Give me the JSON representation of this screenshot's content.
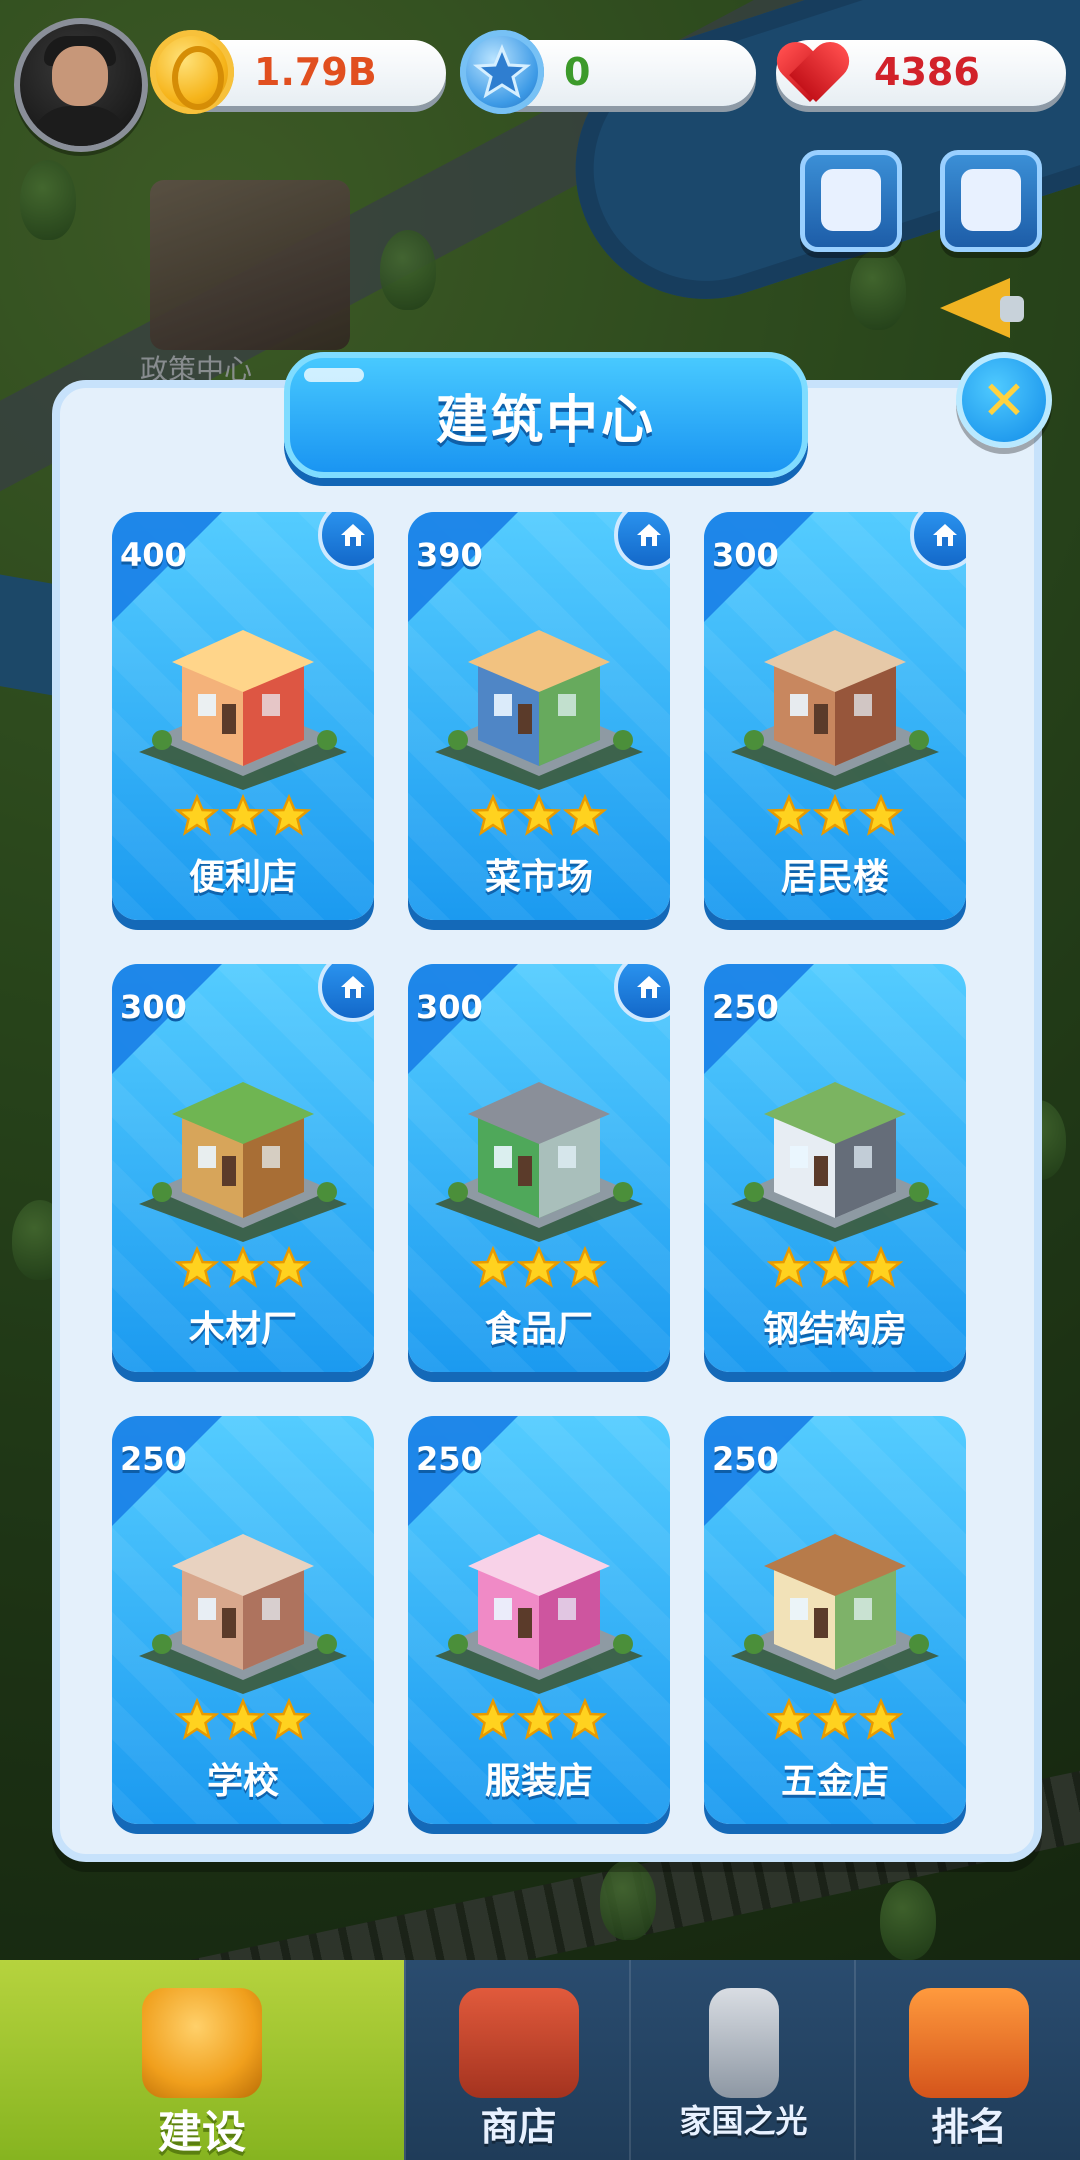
{
  "resources": {
    "coins": "1.79B",
    "stars": "0",
    "hearts": "4386"
  },
  "map": {
    "policy_center_label": "政策中心"
  },
  "modal": {
    "title": "建筑中心",
    "close_symbol": "✕"
  },
  "buildings": [
    {
      "cost": "400",
      "name": "便利店",
      "stars": 3,
      "home_badge": true
    },
    {
      "cost": "390",
      "name": "菜市场",
      "stars": 3,
      "home_badge": true
    },
    {
      "cost": "300",
      "name": "居民楼",
      "stars": 3,
      "home_badge": true
    },
    {
      "cost": "300",
      "name": "木材厂",
      "stars": 3,
      "home_badge": true
    },
    {
      "cost": "300",
      "name": "食品厂",
      "stars": 3,
      "home_badge": true
    },
    {
      "cost": "250",
      "name": "钢结构房",
      "stars": 3,
      "home_badge": false
    },
    {
      "cost": "250",
      "name": "学校",
      "stars": 3,
      "home_badge": false
    },
    {
      "cost": "250",
      "name": "服装店",
      "stars": 3,
      "home_badge": false
    },
    {
      "cost": "250",
      "name": "五金店",
      "stars": 3,
      "home_badge": false
    }
  ],
  "nav": {
    "items": [
      {
        "label": "建设",
        "active": true,
        "icon": "helmet-icon"
      },
      {
        "label": "商店",
        "active": false,
        "icon": "shop-icon"
      },
      {
        "label": "家国之光",
        "active": false,
        "icon": "rocket-icon"
      },
      {
        "label": "排名",
        "active": false,
        "icon": "ranking-icon"
      }
    ]
  },
  "colors": {
    "card_blue": "#1b9af0",
    "title_blue": "#1a95f2",
    "nav_active": "#86b420",
    "coin_text": "#e14f1f",
    "star_text": "#3c9a2a",
    "heart_text": "#d2222a"
  }
}
